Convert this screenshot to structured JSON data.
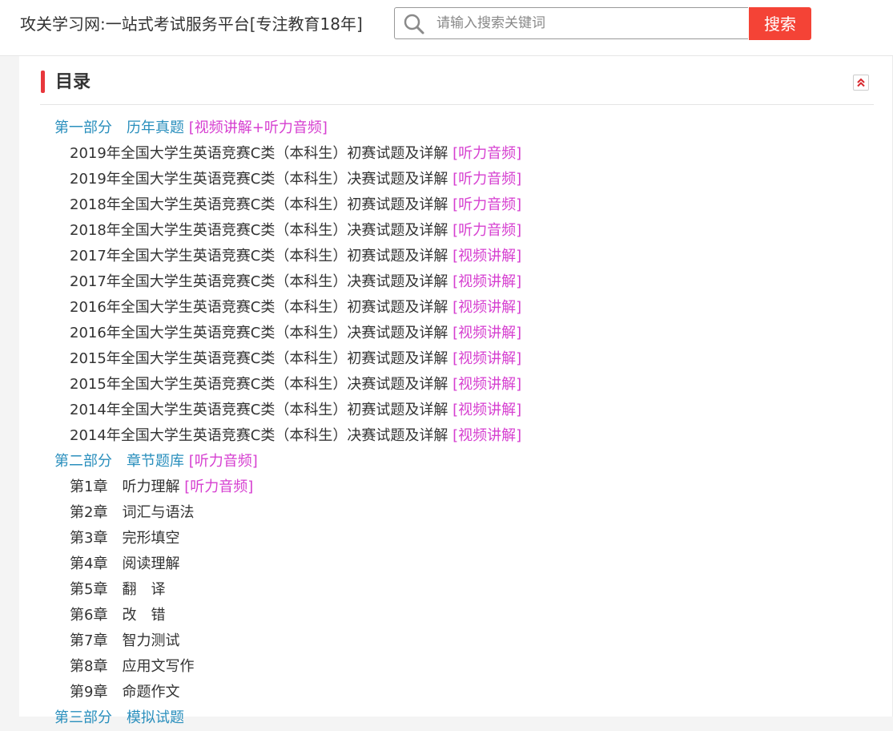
{
  "header": {
    "site_title": "攻关学习网:一站式考试服务平台[专注教育18年]",
    "search_placeholder": "请输入搜索关键词",
    "search_button": "搜索"
  },
  "toc": {
    "title": "目录",
    "collapse_icon": "double-chevron-up-icon",
    "parts": [
      {
        "label": "第一部分",
        "name": "历年真题",
        "tag": "[视频讲解+听力音频]",
        "items": [
          {
            "text": "2019年全国大学生英语竞赛C类（本科生）初赛试题及详解",
            "tag": "[听力音频]"
          },
          {
            "text": "2019年全国大学生英语竞赛C类（本科生）决赛试题及详解",
            "tag": "[听力音频]"
          },
          {
            "text": "2018年全国大学生英语竞赛C类（本科生）初赛试题及详解",
            "tag": "[听力音频]"
          },
          {
            "text": "2018年全国大学生英语竞赛C类（本科生）决赛试题及详解",
            "tag": "[听力音频]"
          },
          {
            "text": "2017年全国大学生英语竞赛C类（本科生）初赛试题及详解",
            "tag": "[视频讲解]"
          },
          {
            "text": "2017年全国大学生英语竞赛C类（本科生）决赛试题及详解",
            "tag": "[视频讲解]"
          },
          {
            "text": "2016年全国大学生英语竞赛C类（本科生）初赛试题及详解",
            "tag": "[视频讲解]"
          },
          {
            "text": "2016年全国大学生英语竞赛C类（本科生）决赛试题及详解",
            "tag": "[视频讲解]"
          },
          {
            "text": "2015年全国大学生英语竞赛C类（本科生）初赛试题及详解",
            "tag": "[视频讲解]"
          },
          {
            "text": "2015年全国大学生英语竞赛C类（本科生）决赛试题及详解",
            "tag": "[视频讲解]"
          },
          {
            "text": "2014年全国大学生英语竞赛C类（本科生）初赛试题及详解",
            "tag": "[视频讲解]"
          },
          {
            "text": "2014年全国大学生英语竞赛C类（本科生）决赛试题及详解",
            "tag": "[视频讲解]"
          }
        ]
      },
      {
        "label": "第二部分",
        "name": "章节题库",
        "tag": "[听力音频]",
        "items": [
          {
            "text": "第1章",
            "name": "听力理解",
            "tag": "[听力音频]"
          },
          {
            "text": "第2章",
            "name": "词汇与语法",
            "tag": ""
          },
          {
            "text": "第3章",
            "name": "完形填空",
            "tag": ""
          },
          {
            "text": "第4章",
            "name": "阅读理解",
            "tag": ""
          },
          {
            "text": "第5章",
            "name": "翻　译",
            "tag": ""
          },
          {
            "text": "第6章",
            "name": "改　错",
            "tag": ""
          },
          {
            "text": "第7章",
            "name": "智力测试",
            "tag": ""
          },
          {
            "text": "第8章",
            "name": "应用文写作",
            "tag": ""
          },
          {
            "text": "第9章",
            "name": "命题作文",
            "tag": ""
          }
        ]
      },
      {
        "label": "第三部分",
        "name": "模拟试题",
        "tag": "",
        "items": []
      }
    ]
  },
  "colors": {
    "accent_red": "#f44336",
    "part_blue": "#2a8fbd",
    "tag_magenta": "#d63fd0",
    "title_bar_red": "#e8373c"
  }
}
